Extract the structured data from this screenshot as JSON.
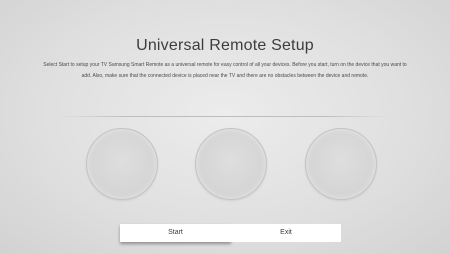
{
  "header": {
    "title": "Universal Remote Setup",
    "description": "Select Start to setup your TV Samsung Smart Remote as a universal remote for easy control of all your devices. Before you start, turn on the device that you want to add. Also, make sure that the connected device is placed near the TV and there are no obstacles between the device and remote."
  },
  "buttons": {
    "start_label": "Start",
    "exit_label": "Exit"
  },
  "colors": {
    "background": "#e3e3e3",
    "button": "#ffffff",
    "text": "#3a3a3a"
  }
}
